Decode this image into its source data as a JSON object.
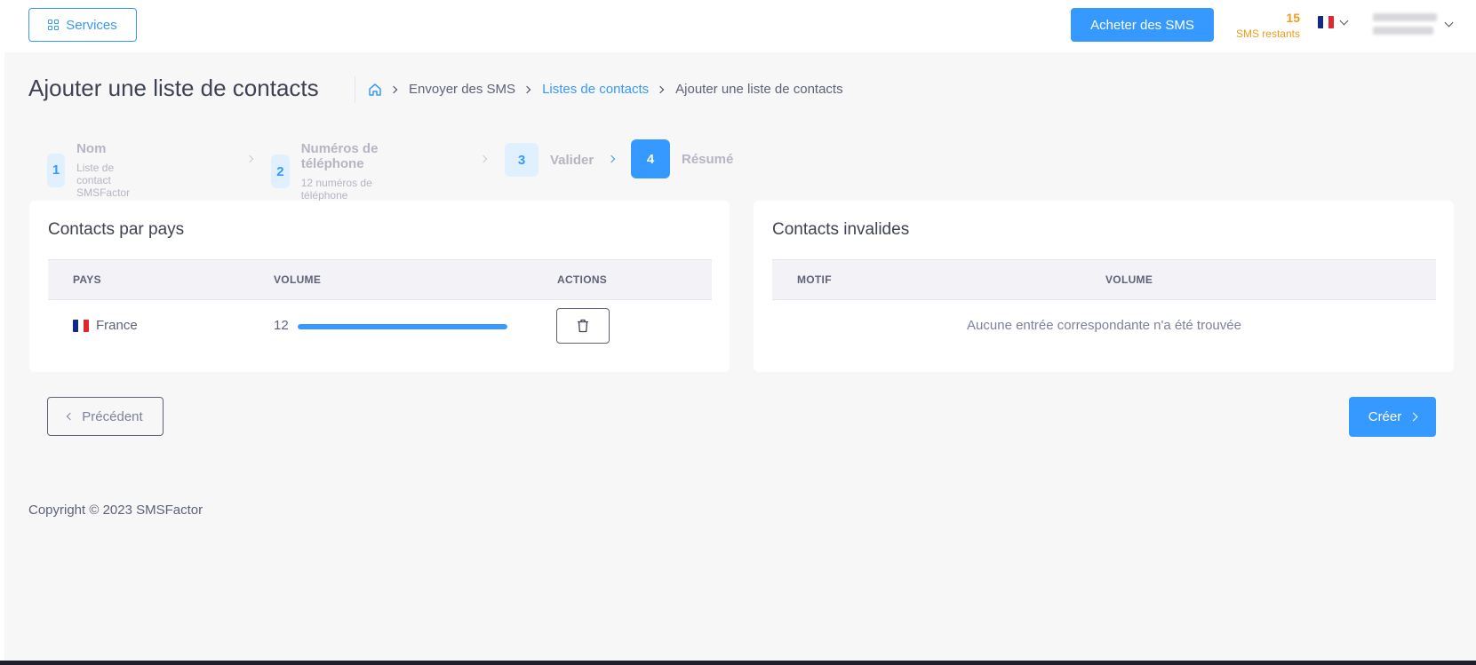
{
  "header": {
    "services_label": "Services",
    "buy_label": "Acheter des SMS",
    "sms_remaining_count": "15",
    "sms_remaining_label": "SMS restants",
    "language_flag": "flag-fr-icon",
    "accent_color": "#3699ff",
    "sms_count_color": "#f59b1e"
  },
  "page": {
    "title": "Ajouter une liste de contacts"
  },
  "breadcrumb": {
    "home_icon": "home-icon",
    "items": [
      "Envoyer des SMS",
      "Listes de contacts",
      "Ajouter une liste de contacts"
    ]
  },
  "stepper": {
    "steps": [
      {
        "number": "1",
        "title": "Nom",
        "subtitle": "Liste de contact SMSFactor"
      },
      {
        "number": "2",
        "title": "Numéros de téléphone",
        "subtitle": "12 numéros de téléphone"
      },
      {
        "number": "3",
        "title": "Valider",
        "subtitle": ""
      },
      {
        "number": "4",
        "title": "Résumé",
        "subtitle": ""
      }
    ],
    "active_step": "4"
  },
  "contacts_by_country": {
    "title": "Contacts par pays",
    "columns": [
      "PAYS",
      "VOLUME",
      "ACTIONS"
    ],
    "rows": [
      {
        "flag": "flag-fr-icon",
        "country": "France",
        "volume": "12",
        "volume_fraction": 1.0
      }
    ]
  },
  "invalid_contacts": {
    "title": "Contacts invalides",
    "columns": [
      "MOTIF",
      "VOLUME"
    ],
    "empty_message": "Aucune entrée correspondante n'a été trouvée"
  },
  "actions": {
    "prev_label": "Précédent",
    "create_label": "Créer"
  },
  "footer": {
    "copyright": "Copyright © 2023 SMSFactor"
  }
}
